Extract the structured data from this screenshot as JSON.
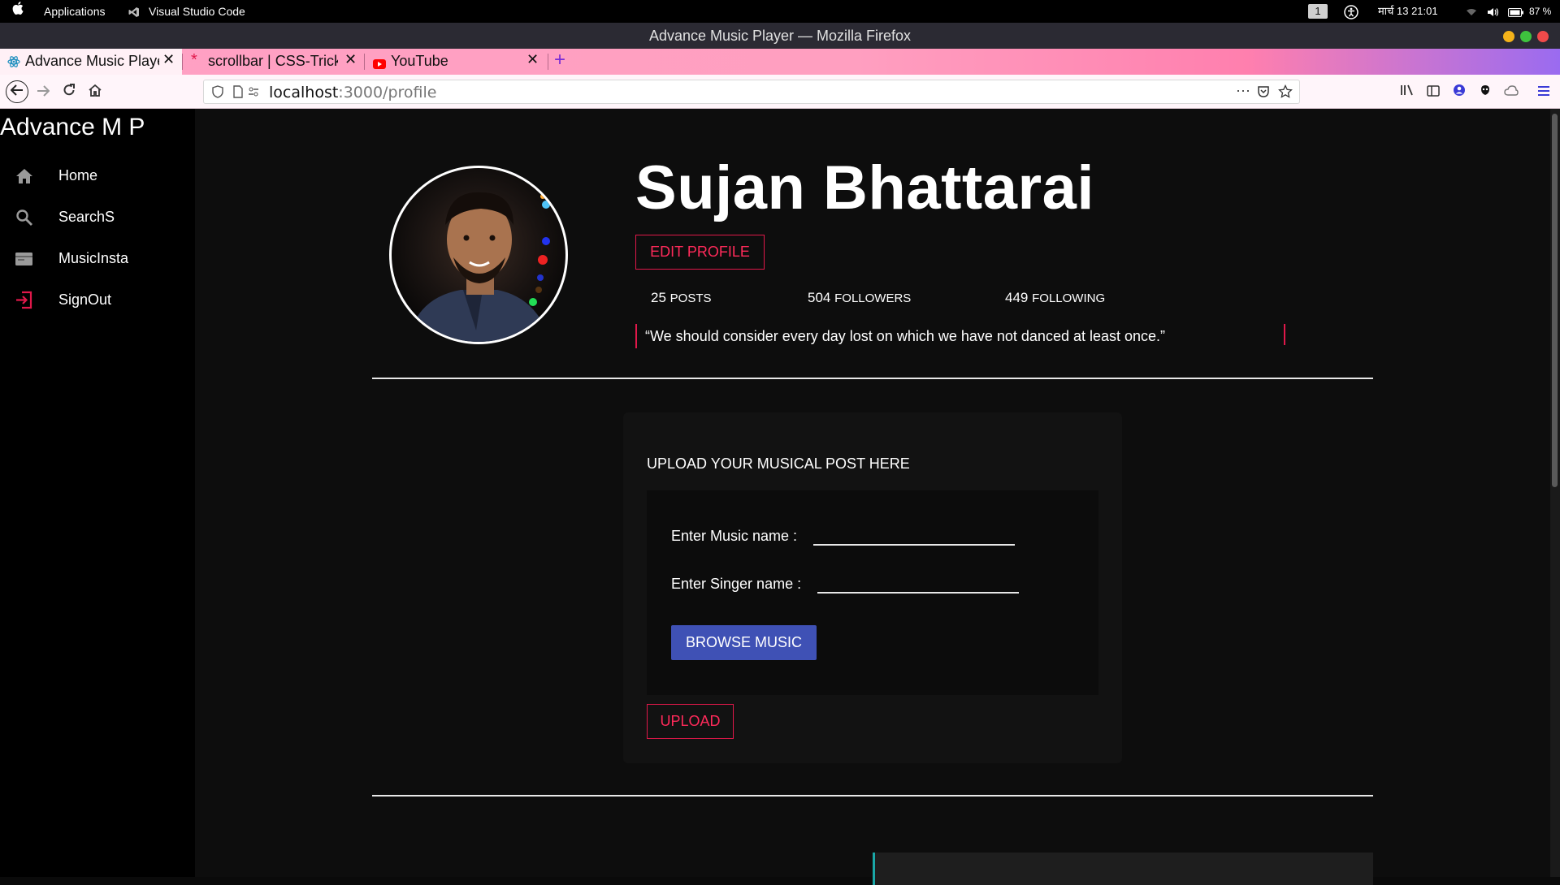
{
  "os_bar": {
    "apps_label": "Applications",
    "active_app": "Visual Studio Code",
    "workspace": "1",
    "datetime": "मार्च 13  21:01",
    "battery": "87 %"
  },
  "window": {
    "title": "Advance Music Player — Mozilla Firefox"
  },
  "tabs": [
    {
      "label": "Advance Music Player",
      "active": true
    },
    {
      "label": "scrollbar | CSS-Tricks",
      "active": false
    },
    {
      "label": "YouTube",
      "active": false
    }
  ],
  "address_bar": {
    "host": "localhost",
    "path": ":3000/profile"
  },
  "sidebar": {
    "brand": "Advance M P",
    "items": [
      {
        "label": "Home",
        "icon": "home-icon"
      },
      {
        "label": "SearchS",
        "icon": "search-icon"
      },
      {
        "label": "MusicInsta",
        "icon": "folder-icon"
      },
      {
        "label": "SignOut",
        "icon": "signout-icon"
      }
    ]
  },
  "profile": {
    "name": "Sujan Bhattarai",
    "edit_label": "EDIT PROFILE",
    "posts_count": "25",
    "posts_label": "POSTS",
    "followers_count": "504",
    "followers_label": "FOLLOWERS",
    "following_count": "449",
    "following_label": "FOLLOWING",
    "quote": "“We should consider every day lost on which we have not danced at least once.”"
  },
  "upload": {
    "title": "UPLOAD YOUR MUSICAL POST HERE",
    "music_label": "Enter Music name :",
    "music_value": "",
    "singer_label": "Enter Singer name :",
    "singer_value": "",
    "browse_label": "BROWSE MUSIC",
    "upload_label": "UPLOAD"
  },
  "colors": {
    "accent_pink": "#e0184a",
    "browse_blue": "#3f51b5",
    "tab_gradient_start": "#ffa1c4",
    "bottom_card_accent": "#1aa7a7"
  }
}
